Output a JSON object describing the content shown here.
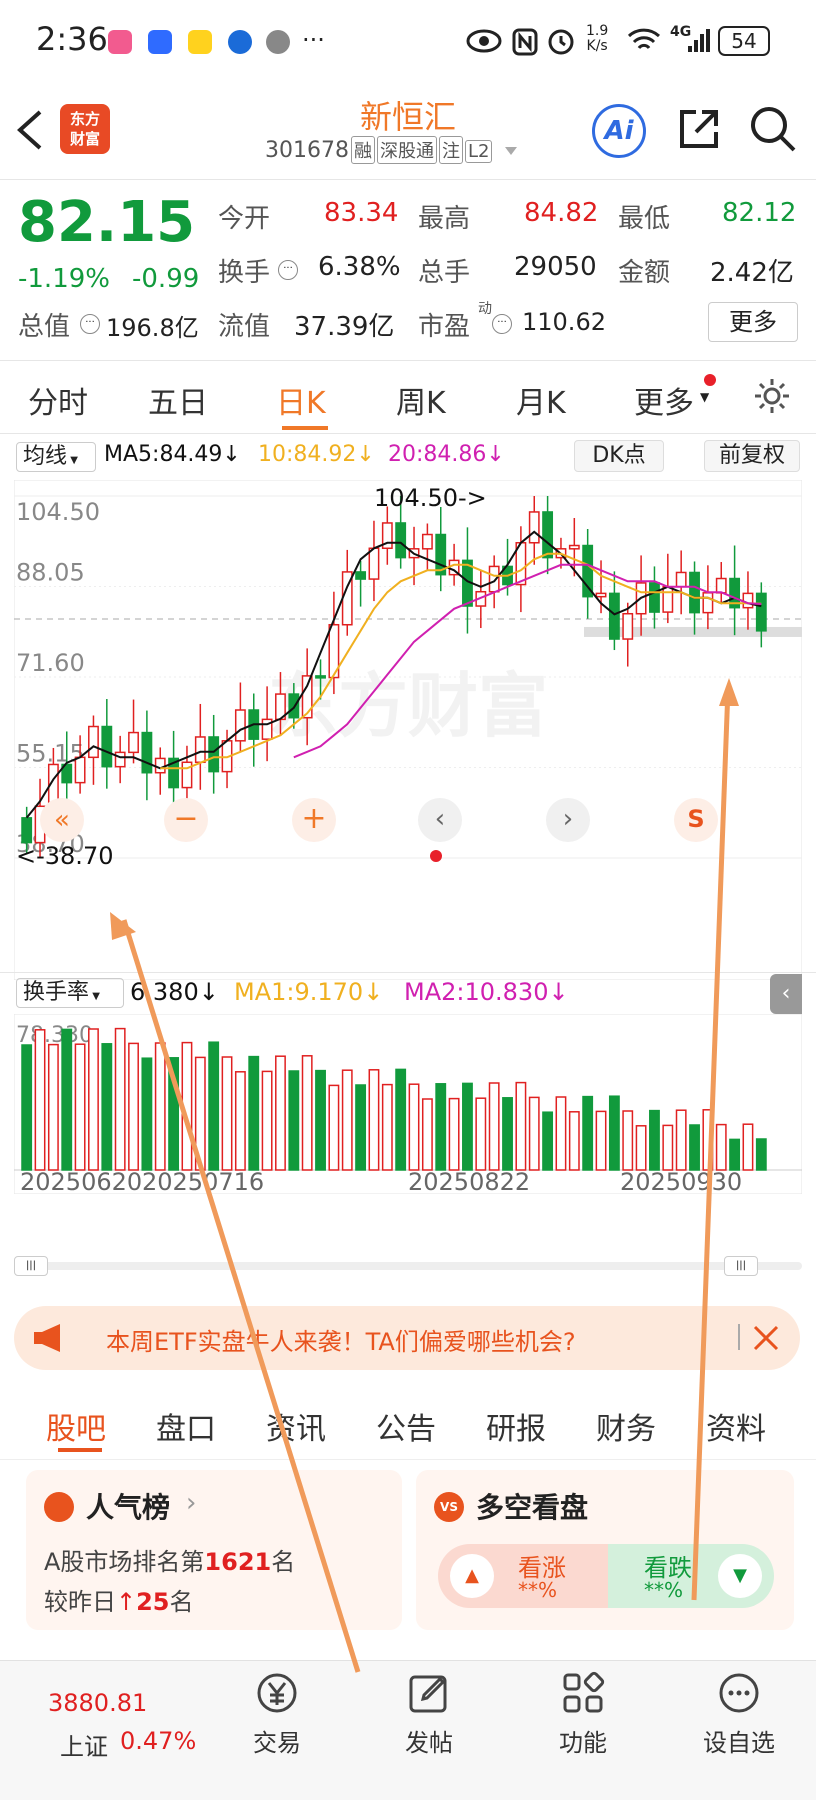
{
  "status_bar": {
    "time": "2:36",
    "net_speed": "1.9\nK/s",
    "signal": "4G",
    "battery": "54"
  },
  "header": {
    "logo_text": "东方\n财富",
    "stock_name": "新恒汇",
    "stock_code": "301678",
    "tags": [
      "融",
      "深股通",
      "注",
      "L2"
    ],
    "ai_label": "Ai"
  },
  "quote": {
    "price": "82.15",
    "change_pct": "-1.19%",
    "change": "-0.99",
    "open_label": "今开",
    "open": "83.34",
    "high_label": "最高",
    "high": "84.82",
    "low_label": "最低",
    "low": "82.12",
    "turnover_label": "换手",
    "turnover": "6.38%",
    "volume_label": "总手",
    "volume": "29050",
    "amount_label": "金额",
    "amount": "2.42亿",
    "mktcap_label": "总值",
    "mktcap": "196.8亿",
    "float_label": "流值",
    "float": "37.39亿",
    "pe_label": "市盈",
    "pe_sup": "动",
    "pe": "110.62",
    "more_label": "更多"
  },
  "period_tabs": {
    "items": [
      "分时",
      "五日",
      "日K",
      "周K",
      "月K",
      "更多"
    ],
    "active": "日K"
  },
  "kline": {
    "ma_select": "均线",
    "ma5": "MA5:84.49↓",
    "ma10": "10:84.92↓",
    "ma20": "20:84.86↓",
    "dk_label": "DK点",
    "fq_label": "前复权",
    "y_labels": [
      "104.50",
      "88.05",
      "71.60",
      "55.15",
      "38.70"
    ],
    "high_annot": "104.50->",
    "low_annot": "<-38.70",
    "watermark": "东方财富",
    "colors": {
      "up": "#e02020",
      "down": "#119a3c",
      "ma5": "#111111",
      "ma10": "#f0b020",
      "ma20": "#d020b0"
    }
  },
  "chart_data": {
    "type": "candlestick",
    "ylim": [
      38.7,
      104.5
    ],
    "series": [
      {
        "name": "MA5",
        "values": [
          46,
          49,
          53,
          56,
          57,
          59,
          58,
          57,
          57,
          56,
          55,
          56,
          57,
          58,
          58,
          60,
          62,
          63,
          63,
          64,
          66,
          70,
          76,
          82,
          88,
          93,
          95,
          96,
          96,
          94,
          93,
          92,
          91,
          89,
          88,
          89,
          92,
          96,
          98,
          96,
          94,
          91,
          88,
          85,
          83,
          84,
          86,
          87,
          88,
          87,
          86,
          86,
          85,
          86,
          85,
          84.49
        ]
      },
      {
        "name": "MA10",
        "values": [
          null,
          null,
          null,
          null,
          null,
          null,
          null,
          null,
          null,
          null,
          55,
          55,
          55,
          56,
          57,
          57,
          58,
          59,
          60,
          61,
          63,
          65,
          68,
          72,
          76,
          80,
          84,
          87,
          89,
          90,
          91,
          91,
          92,
          92,
          91,
          90,
          90,
          91,
          93,
          94,
          94,
          93,
          92,
          90,
          89,
          88,
          87,
          87,
          87,
          87,
          86,
          86,
          85,
          85,
          85,
          84.92
        ]
      },
      {
        "name": "MA20",
        "values": [
          null,
          null,
          null,
          null,
          null,
          null,
          null,
          null,
          null,
          null,
          null,
          null,
          null,
          null,
          null,
          null,
          null,
          null,
          null,
          null,
          57,
          58,
          59,
          61,
          63,
          66,
          69,
          72,
          75,
          78,
          80,
          82,
          84,
          85,
          86,
          87,
          88,
          89,
          90,
          91,
          92,
          92,
          92,
          91,
          90,
          89,
          89,
          89,
          88,
          88,
          88,
          87,
          87,
          86,
          85,
          84.86
        ]
      }
    ],
    "volume_label": "换手率",
    "volume_value": "6.380↓",
    "vol_ma1": "MA1:9.170↓",
    "vol_ma2": "MA2:10.830↓",
    "volume_max_label": "78.330",
    "x_labels": [
      "20250620",
      "20250716",
      "20250822",
      "20250930"
    ]
  },
  "notice": {
    "text": "本周ETF实盘牛人来袭！TA们偏爱哪些机会?"
  },
  "bottom_tabs": {
    "items": [
      "股吧",
      "盘口",
      "资讯",
      "公告",
      "研报",
      "财务",
      "资料"
    ],
    "active": "股吧"
  },
  "popularity": {
    "title": "人气榜",
    "line1_prefix": "A股市场排名第",
    "rank": "1621",
    "line1_suffix": "名",
    "line2_prefix": "较昨日",
    "change": "25",
    "line2_suffix": "名"
  },
  "sentiment": {
    "title": "多空看盘",
    "bull_label": "看涨",
    "bull_value": "**%",
    "bear_label": "看跌",
    "bear_value": "**%"
  },
  "tabbar": {
    "index_value": "3880.81",
    "index_name": "上证",
    "index_change": "0.47%",
    "items": [
      {
        "label": "交易",
        "icon": "yen-trade-icon"
      },
      {
        "label": "发帖",
        "icon": "edit-post-icon"
      },
      {
        "label": "功能",
        "icon": "grid-function-icon"
      },
      {
        "label": "设自选",
        "icon": "more-dots-icon"
      }
    ]
  }
}
